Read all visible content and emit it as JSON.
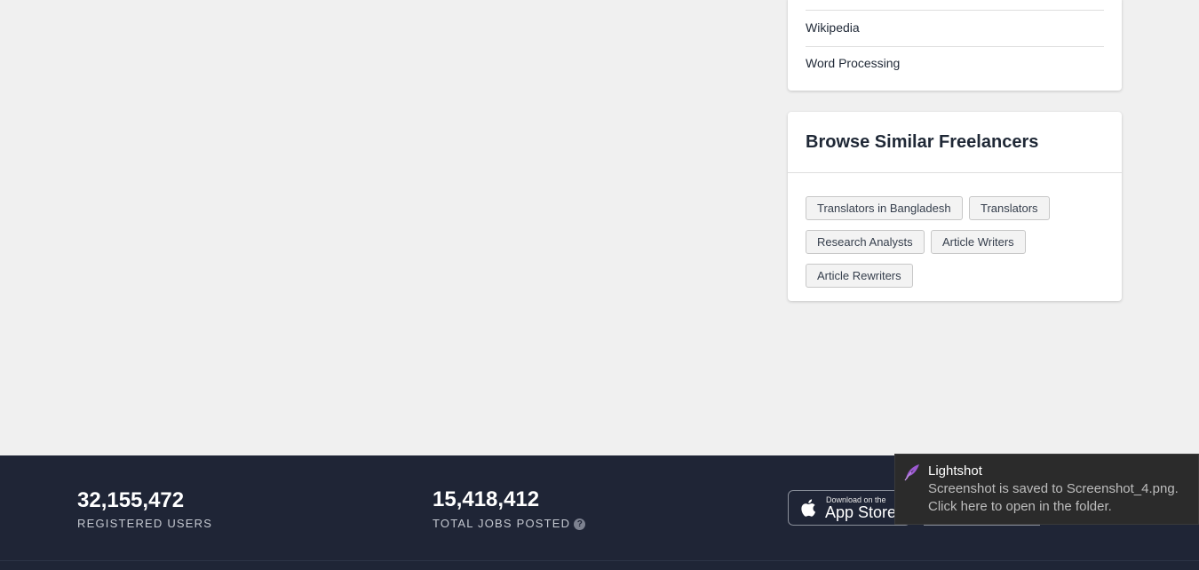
{
  "skills": {
    "items": [
      "Wikipedia",
      "Word Processing"
    ]
  },
  "similar": {
    "title": "Browse Similar Freelancers",
    "tags": [
      "Translators in Bangladesh",
      "Translators",
      "Research Analysts",
      "Article Writers",
      "Article Rewriters"
    ]
  },
  "footer": {
    "registered_users": "32,155,472",
    "registered_users_label": "REGISTERED USERS",
    "total_jobs": "15,418,412",
    "total_jobs_label": "TOTAL JOBS POSTED",
    "help_icon_glyph": "?",
    "app_store_small": "Download on the",
    "app_store_big": "App Store"
  },
  "toast": {
    "title": "Lightshot",
    "line1": "Screenshot is saved to Screenshot_4.png.",
    "line2": "Click here to open in the folder.",
    "icon": "feather-icon",
    "icon_color": "#9b59d0"
  },
  "colors": {
    "footer_bg": "#1f2536",
    "page_bg": "#f0f0f0"
  }
}
